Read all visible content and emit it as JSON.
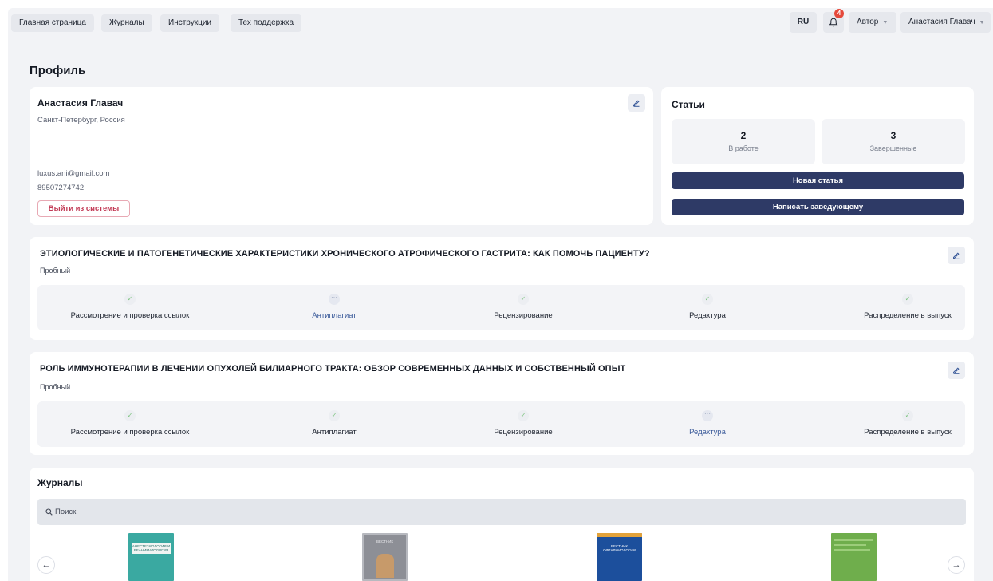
{
  "nav": {
    "items": [
      "Главная страница",
      "Журналы",
      "Инструкции",
      "Тех поддержка"
    ],
    "lang": "RU",
    "notifications_count": "4",
    "role": "Автор",
    "user": "Анастасия Главач"
  },
  "page_title": "Профиль",
  "profile": {
    "name": "Анастасия Главач",
    "location": "Санкт-Петербург, Россия",
    "email": "luxus.ani@gmail.com",
    "phone": "89507274742",
    "logout_label": "Выйти из системы"
  },
  "articles_summary": {
    "heading": "Статьи",
    "in_progress_count": "2",
    "in_progress_label": "В работе",
    "completed_count": "3",
    "completed_label": "Завершенные",
    "new_article_label": "Новая статья",
    "write_manager_label": "Написать заведующему"
  },
  "articles": [
    {
      "title": "ЭТИОЛОГИЧЕСКИЕ И ПАТОГЕНЕТИЧЕСКИЕ ХАРАКТЕРИСТИКИ ХРОНИЧЕСКОГО АТРОФИЧЕСКОГО ГАСТРИТА: КАК ПОМОЧЬ ПАЦИЕНТУ?",
      "type": "Пробный",
      "steps": [
        {
          "label": "Рассмотрение и проверка ссылок",
          "status": "done"
        },
        {
          "label": "Антиплагиат",
          "status": "active"
        },
        {
          "label": "Рецензирование",
          "status": "done"
        },
        {
          "label": "Редактура",
          "status": "done"
        },
        {
          "label": "Распределение в выпуск",
          "status": "done"
        }
      ]
    },
    {
      "title": "РОЛЬ ИММУНОТЕРАПИИ В ЛЕЧЕНИИ ОПУХОЛЕЙ БИЛИАРНОГО ТРАКТА: ОБЗОР СОВРЕМЕННЫХ ДАННЫХ И СОБСТВЕННЫЙ ОПЫТ",
      "type": "Пробный",
      "steps": [
        {
          "label": "Рассмотрение и проверка ссылок",
          "status": "done"
        },
        {
          "label": "Антиплагиат",
          "status": "done"
        },
        {
          "label": "Рецензирование",
          "status": "done"
        },
        {
          "label": "Редактура",
          "status": "active"
        },
        {
          "label": "Распределение в выпуск",
          "status": "done"
        }
      ]
    }
  ],
  "journals": {
    "heading": "Журналы",
    "search_placeholder": "Поиск",
    "covers": [
      {
        "text": "АНЕСТЕЗИОЛОГИЯ И РЕАНИМАТОЛОГИЯ",
        "color": "#3aa9a1"
      },
      {
        "text": "ВЕСТНИК",
        "color": "#8d8f96"
      },
      {
        "text": "ВЕСТНИК ОФТАЛЬМОЛОГИИ",
        "color": "#1c4f9c"
      },
      {
        "text": "",
        "color": "#6fae4c"
      }
    ]
  },
  "colors": {
    "accent": "#2e3a66",
    "danger": "#c23a55",
    "badge": "#e5493b",
    "check": "#7cc37f"
  }
}
